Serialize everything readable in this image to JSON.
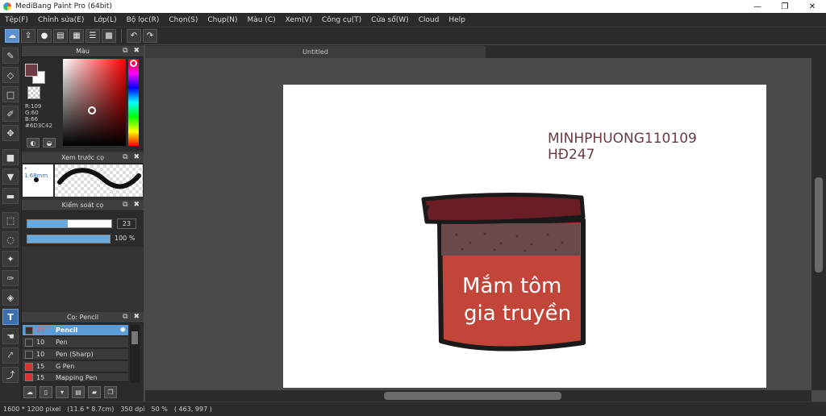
{
  "window": {
    "title": "MediBang Paint Pro (64bit)",
    "controls": [
      "—",
      "❐",
      "✕"
    ]
  },
  "menu": [
    "Tệp(F)",
    "Chỉnh sửa(E)",
    "Lớp(L)",
    "Bộ lọc(R)",
    "Chọn(S)",
    "Chụp(N)",
    "Màu (C)",
    "Xem(V)",
    "Công cụ(T)",
    "Cửa sổ(W)",
    "Cloud",
    "Help"
  ],
  "color_panel": {
    "title": "Màu",
    "fg_color": "#6D3C42",
    "r": "R:109",
    "g": "G:60",
    "b": "B:66",
    "hex": "#6D3C42"
  },
  "brush_preview": {
    "title": "Xem trước cọ",
    "size": "* 1.68mm"
  },
  "brush_control": {
    "title": "Kiểm soát cọ",
    "size_value": "23",
    "size_fraction": 0.48,
    "opacity_value": "100 %",
    "opacity_fraction": 1.0
  },
  "brush_list": {
    "title": "Cọ: Pencil",
    "items": [
      {
        "size": "23",
        "name": "Pencil",
        "color": "#333333",
        "selected": true
      },
      {
        "size": "10",
        "name": "Pen",
        "color": "#333333",
        "selected": false
      },
      {
        "size": "10",
        "name": "Pen (Sharp)",
        "color": "#333333",
        "selected": false
      },
      {
        "size": "15",
        "name": "G Pen",
        "color": "#e03030",
        "selected": false
      },
      {
        "size": "15",
        "name": "Mapping Pen",
        "color": "#e03030",
        "selected": false
      }
    ]
  },
  "document": {
    "tab": "Untitled"
  },
  "artwork": {
    "text_line1": "MINHPHUONG110109",
    "text_line2": "HĐ247",
    "label_line1": "Mắm tôm",
    "label_line2": "gia truyền",
    "lid_color": "#6a1d25",
    "band_color": "#6b4a4e",
    "body_color": "#c2453a",
    "ink_color": "#1a1a1a",
    "text_color": "#6b3b40"
  },
  "status": {
    "pixels": "1600 * 1200 pixel",
    "size": "(11.6 * 8.7cm)",
    "dpi": "350 dpi",
    "zoom": "50 %",
    "coords": "( 463, 997 )"
  }
}
